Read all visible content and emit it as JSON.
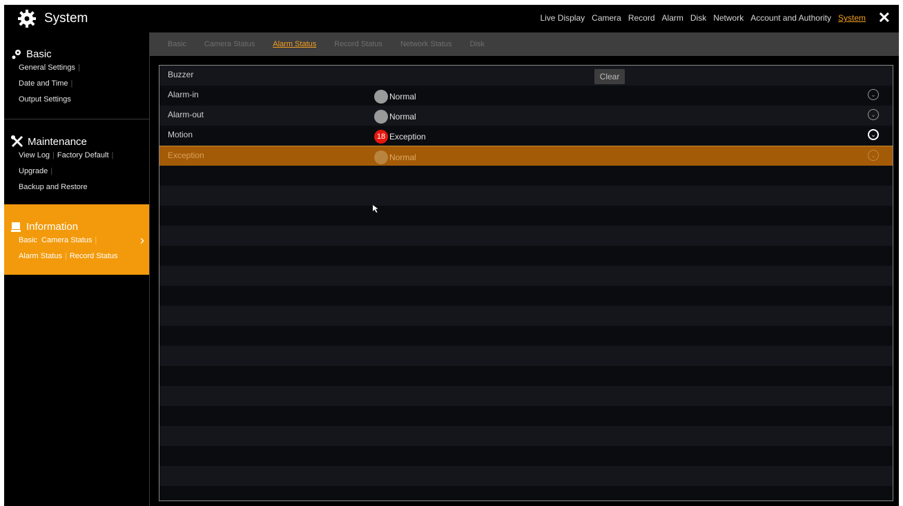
{
  "window": {
    "title": "System",
    "close_label": "✕"
  },
  "topnav": [
    "Live Display",
    "Camera",
    "Record",
    "Alarm",
    "Disk",
    "Network",
    "Account and Authority",
    "System"
  ],
  "topnav_active": "System",
  "sidebar": {
    "basic": {
      "title": "Basic",
      "links": [
        "General Settings",
        "Date and Time",
        "Output Settings"
      ]
    },
    "maintenance": {
      "title": "Maintenance",
      "links": [
        "View Log",
        "Factory Default",
        "Upgrade",
        "Backup and Restore"
      ]
    },
    "information": {
      "title": "Information",
      "links": [
        "Basic",
        "Camera Status",
        "Alarm Status",
        "Record Status"
      ]
    }
  },
  "tabs": [
    "Basic",
    "Camera Status",
    "Alarm Status",
    "Record Status",
    "Network Status",
    "Disk"
  ],
  "tab_active": "Alarm Status",
  "alarm_table": {
    "buzzer_label": "Buzzer",
    "clear_label": "Clear",
    "rows": [
      {
        "label": "Alarm-in",
        "status": "Normal"
      },
      {
        "label": "Alarm-out",
        "status": "Normal"
      },
      {
        "label": "Motion",
        "status": "Exception",
        "badge": "18"
      },
      {
        "label": "Exception",
        "status": "Normal"
      }
    ]
  },
  "colors": {
    "accent": "#f39a0c",
    "exception_red": "#e5180e",
    "selected_row": "#a35b08"
  }
}
